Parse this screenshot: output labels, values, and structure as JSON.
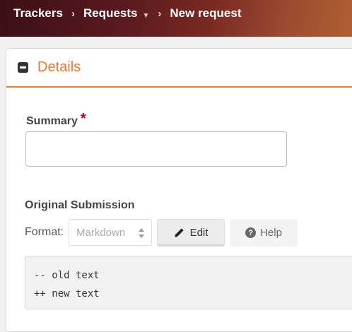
{
  "breadcrumb": {
    "items": [
      {
        "label": "Trackers"
      },
      {
        "label": "Requests"
      },
      {
        "label": "New request"
      }
    ]
  },
  "panel": {
    "title": "Details"
  },
  "form": {
    "summary_label": "Summary",
    "required_mark": "*",
    "summary_value": "",
    "original_submission_label": "Original Submission",
    "format_label": "Format:",
    "format_selected": "Markdown",
    "edit_label": "Edit",
    "help_label": "Help",
    "editor_lines": [
      "-- old text",
      "++ new text"
    ]
  },
  "colors": {
    "accent": "#e8772b",
    "required": "#c0001a"
  },
  "icons": [
    "chevron-right-icon",
    "caret-down-icon",
    "collapse-icon",
    "pencil-icon",
    "help-icon"
  ]
}
